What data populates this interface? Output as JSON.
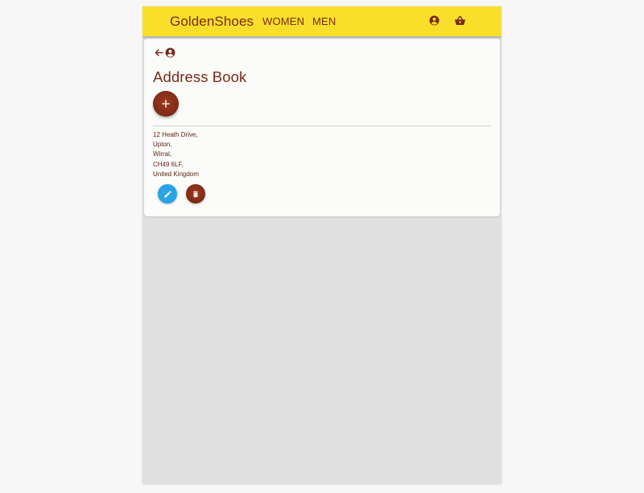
{
  "header": {
    "brand": "GoldenShoes",
    "nav": [
      {
        "label": "WOMEN"
      },
      {
        "label": "MEN"
      }
    ],
    "icons": [
      "account-circle-icon",
      "shopping-basket-icon"
    ]
  },
  "page": {
    "title": "Address Book",
    "icons": [
      "arrow-left-icon",
      "account-circle-icon",
      "plus-icon"
    ]
  },
  "addresses": [
    {
      "lines": [
        "12 Heath Drive,",
        "Upton,",
        "Wirral,",
        "CH49 6LF,",
        "United Kingdom"
      ],
      "actions": [
        "edit-pencil-icon",
        "trash-icon"
      ]
    }
  ],
  "colors": {
    "header_bg": "#f9df2a",
    "brand_text": "#7a2a16",
    "primary_button": "#7c2a14",
    "edit_button": "#27a3e8",
    "content_bg": "#e0e0e0",
    "card_bg": "#fbfbfa"
  }
}
